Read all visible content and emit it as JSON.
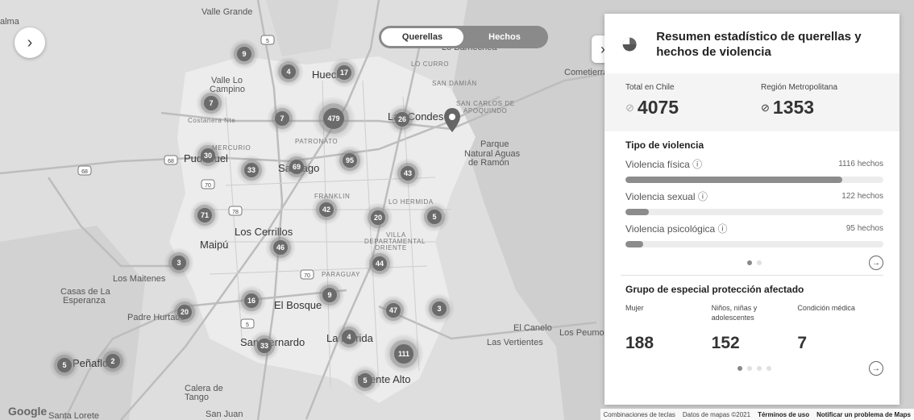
{
  "map": {
    "toggle": {
      "querellas": "Querellas",
      "hechos": "Hechos"
    },
    "places": [
      {
        "name": "Valle Grande",
        "style": "normal"
      },
      {
        "name": "Valle Lo",
        "style": "normal"
      },
      {
        "name": "Campino",
        "style": "normal"
      },
      {
        "name": "Costanera Nte",
        "style": "small"
      },
      {
        "name": "MERCURIO",
        "style": "small"
      },
      {
        "name": "PATRONATO",
        "style": "small"
      },
      {
        "name": "LO CURRO",
        "style": "small"
      },
      {
        "name": "SAN DAMIÁN",
        "style": "small"
      },
      {
        "name": "SAN CARLOS DE",
        "style": "small"
      },
      {
        "name": "APOQUINDO",
        "style": "small"
      },
      {
        "name": "Lo Barnechea",
        "style": "normal"
      },
      {
        "name": "Hueche",
        "style": "big"
      },
      {
        "name": "Las Condes",
        "style": "big"
      },
      {
        "name": "Parque",
        "style": "normal"
      },
      {
        "name": "Natural Aguas",
        "style": "normal"
      },
      {
        "name": "de Ramón",
        "style": "normal"
      },
      {
        "name": "Pudahuel",
        "style": "big"
      },
      {
        "name": "Santiago",
        "style": "big"
      },
      {
        "name": "FRANKLIN",
        "style": "small"
      },
      {
        "name": "LO HERMIDA",
        "style": "small"
      },
      {
        "name": "Maipú",
        "style": "big"
      },
      {
        "name": "Los Cerrillos",
        "style": "big"
      },
      {
        "name": "VILLA",
        "style": "small"
      },
      {
        "name": "DEPARTAMENTAL",
        "style": "small"
      },
      {
        "name": "ORIENTE",
        "style": "small"
      },
      {
        "name": "PARAGUAY",
        "style": "small"
      },
      {
        "name": "Los Maitenes",
        "style": "normal"
      },
      {
        "name": "Casas de La",
        "style": "normal"
      },
      {
        "name": "Esperanza",
        "style": "normal"
      },
      {
        "name": "Padre Hurtado",
        "style": "normal"
      },
      {
        "name": "El Bosque",
        "style": "big"
      },
      {
        "name": "San Bernardo",
        "style": "big"
      },
      {
        "name": "La Florida",
        "style": "big"
      },
      {
        "name": "Puente Alto",
        "style": "big"
      },
      {
        "name": "Peñaflor",
        "style": "big"
      },
      {
        "name": "Calera de",
        "style": "normal"
      },
      {
        "name": "Tango",
        "style": "normal"
      },
      {
        "name": "San Juan",
        "style": "normal"
      },
      {
        "name": "Santa Lorete",
        "style": "normal"
      },
      {
        "name": "El Canelo",
        "style": "normal"
      },
      {
        "name": "Las Vertientes",
        "style": "normal"
      },
      {
        "name": "Los Peumos",
        "style": "normal"
      },
      {
        "name": "Cometierra",
        "style": "normal"
      },
      {
        "name": "alma",
        "style": "normal"
      }
    ],
    "route_badges": [
      "5",
      "68",
      "68",
      "70",
      "78",
      "70",
      "5"
    ],
    "clusters": [
      "9",
      "4",
      "17",
      "7",
      "7",
      "479",
      "26",
      "30",
      "33",
      "69",
      "95",
      "43",
      "71",
      "42",
      "20",
      "5",
      "46",
      "3",
      "44",
      "9",
      "16",
      "20",
      "47",
      "3",
      "33",
      "4",
      "111",
      "2",
      "5",
      "5"
    ],
    "attribution": {
      "keys": "Combinaciones de teclas",
      "data": "Datos de mapas ©2021",
      "terms": "Términos de uso",
      "report": "Notificar un problema de Maps",
      "logo": "Google"
    }
  },
  "panel": {
    "title": "Resumen estadístico de querellas y hechos de violencia",
    "totals": {
      "chile_label": "Total en Chile",
      "chile_value": "4075",
      "region_label": "Región Metropolitana",
      "region_value": "1353"
    },
    "violence": {
      "title": "Tipo de violencia",
      "items": [
        {
          "label": "Violencia física",
          "count": "1116 hechos",
          "fraction": 0.84
        },
        {
          "label": "Violencia sexual",
          "count": "122 hechos",
          "fraction": 0.09
        },
        {
          "label": "Violencia psicológica",
          "count": "95 hechos",
          "fraction": 0.07
        }
      ]
    },
    "groups": {
      "title": "Grupo de especial protección afectado",
      "items": [
        {
          "label": "Mujer",
          "value": "188"
        },
        {
          "label": "Niños, niñas y adolescentes",
          "value": "152"
        },
        {
          "label": "Condición médica",
          "value": "7"
        }
      ]
    }
  }
}
